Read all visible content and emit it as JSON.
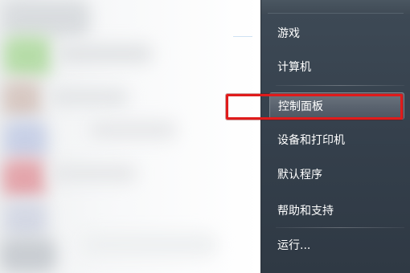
{
  "start_menu": {
    "right_items": [
      {
        "label": "游戏"
      },
      {
        "label": "计算机"
      },
      {
        "label": "控制面板"
      },
      {
        "label": "设备和打印机"
      },
      {
        "label": "默认程序"
      },
      {
        "label": "帮助和支持"
      },
      {
        "label": "运行..."
      }
    ]
  },
  "annotation": {
    "color": "#e01b1b",
    "target": "控制面板"
  },
  "colors": {
    "menu_panel": "#343f4b",
    "menu_text": "#ffffff"
  }
}
